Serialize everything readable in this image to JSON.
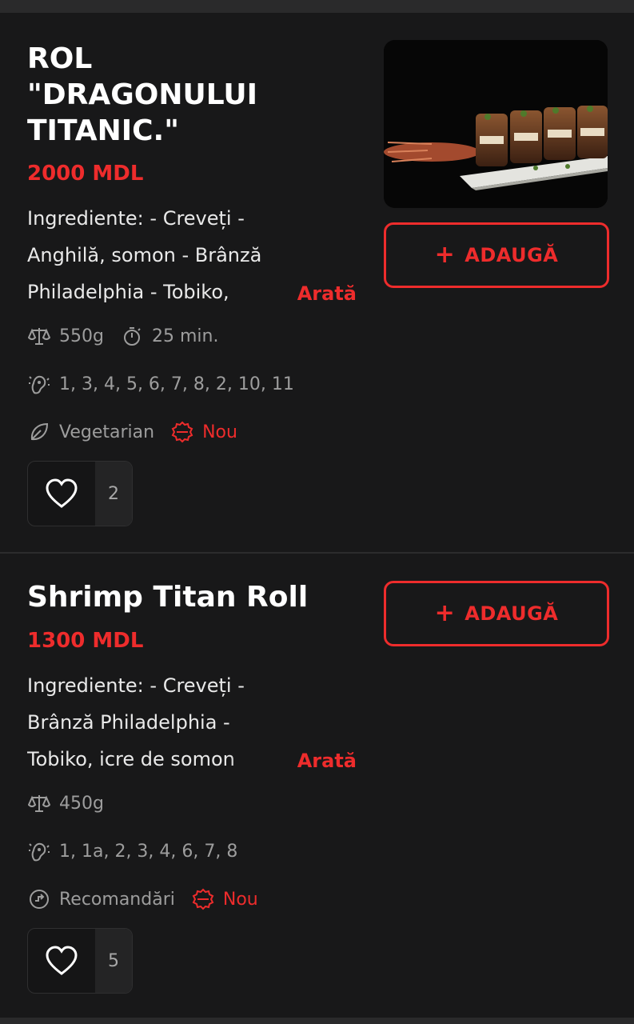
{
  "products": [
    {
      "title": "ROL\n\"DRAGONULUI\nTITANIC.\"",
      "price": "2000 MDL",
      "description": "Ingrediente: - Creveți - Anghilă, somon - Brânză Philadelphia - Tobiko,",
      "more_label": "Arată",
      "weight": "550g",
      "time": "25 min.",
      "allergens": "1, 3, 4, 5, 6, 7, 8, 2, 10, 11",
      "category": "Vegetarian",
      "badge": "Nou",
      "add_label": "ADAUGĂ",
      "likes": "2"
    },
    {
      "title": "Shrimp Titan Roll",
      "price": "1300 MDL",
      "description": "Ingrediente: - Creveți - Brânză Philadelphia - Tobiko, icre de somon",
      "more_label": "Arată",
      "weight": "450g",
      "allergens": "1, 1a, 2, 3, 4, 6, 7, 8",
      "category": "Recomandări",
      "badge": "Nou",
      "add_label": "ADAUGĂ",
      "likes": "5"
    }
  ],
  "colors": {
    "accent": "#ee2c2c",
    "background": "#181819",
    "muted": "#9d9d9d"
  },
  "icons": {
    "weight": "scale-icon",
    "time": "timer-icon",
    "allergens": "allergen-icon",
    "vegetarian": "leaf-icon",
    "recommended": "recommend-icon",
    "new": "new-badge-icon",
    "like": "heart-icon",
    "add": "plus-icon"
  }
}
